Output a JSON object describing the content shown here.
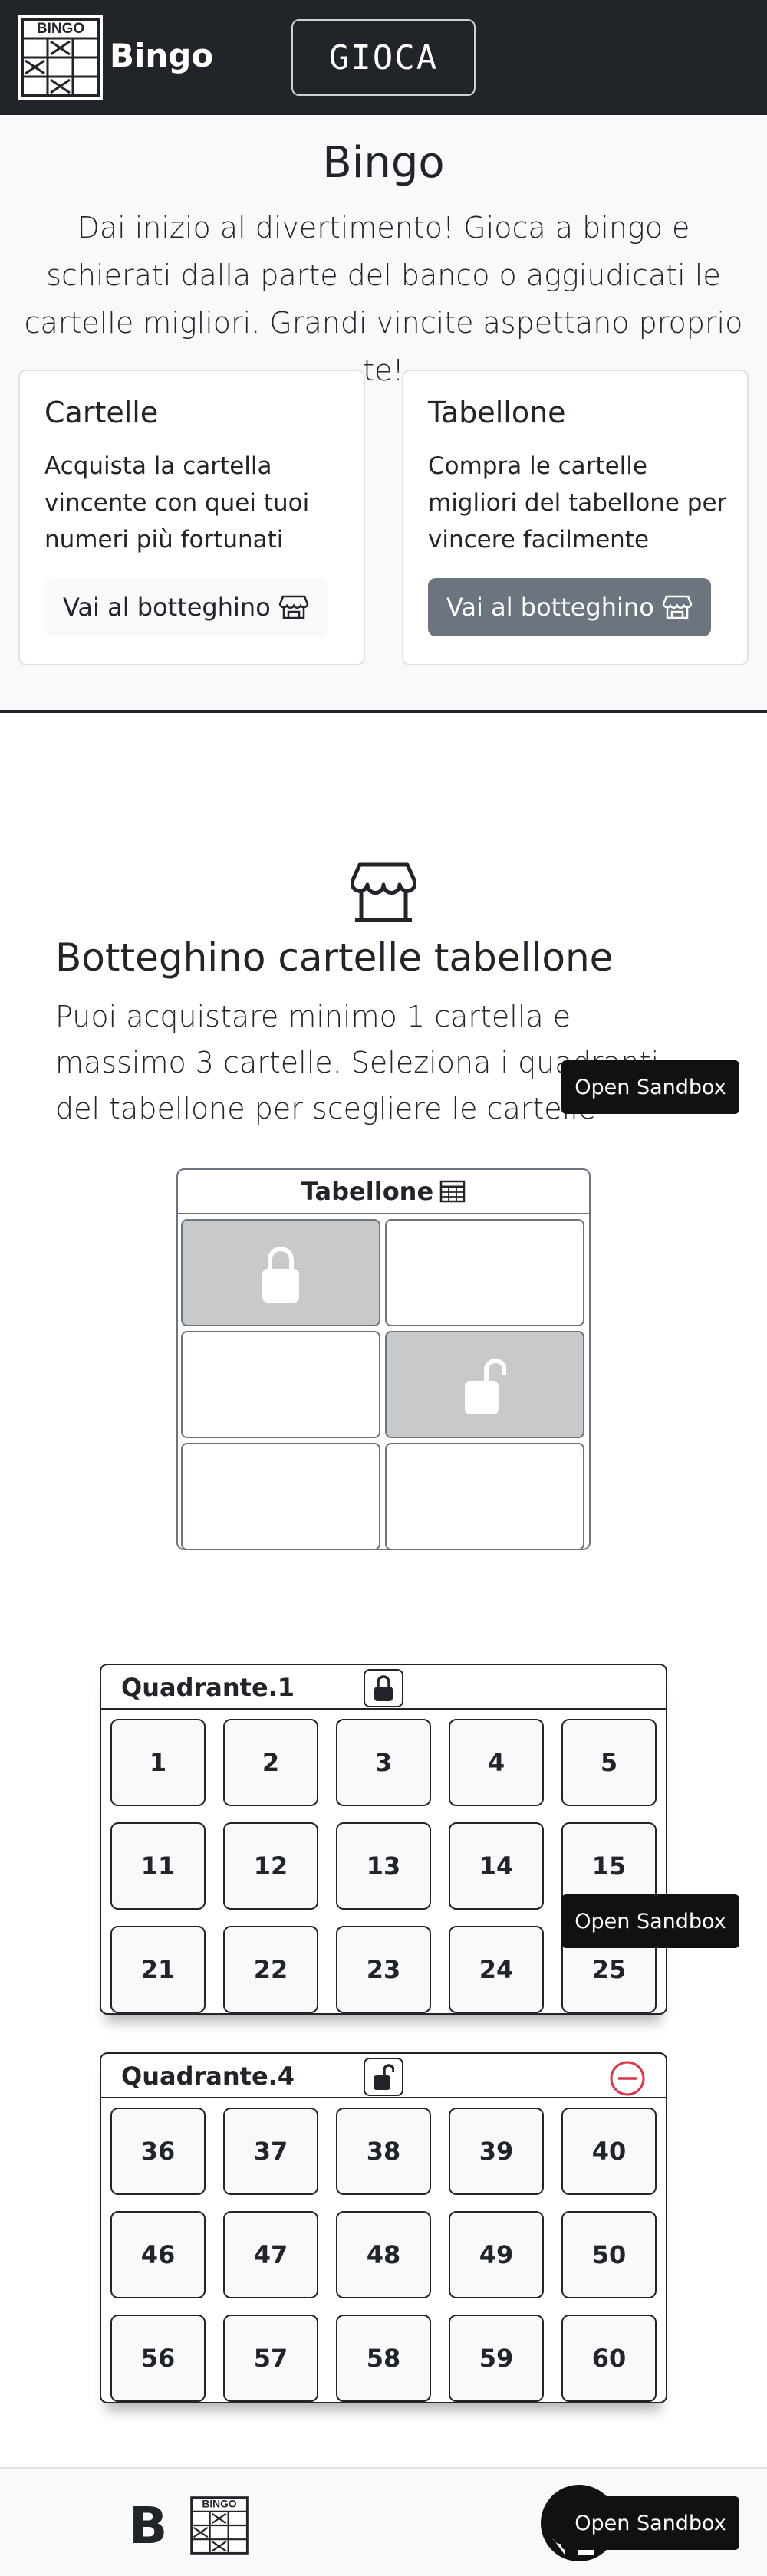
{
  "header": {
    "logo_text": "BINGO",
    "brand": "Bingo",
    "play_label": "GIOCA"
  },
  "hero": {
    "title": "Bingo",
    "lead": "Dai inizio al divertimento! Gioca a bingo e schierati dalla parte del banco o aggiudicati le cartelle migliori. Grandi vincite aspettano proprio te!",
    "cards": [
      {
        "title": "Cartelle",
        "text": "Acquista la cartella vincente con quei tuoi numeri più fortunati",
        "button": "Vai al botteghino",
        "icon": "store-icon",
        "style": "light"
      },
      {
        "title": "Tabellone",
        "text": "Compra le cartelle migliori del tabellone per vincere facilmente",
        "button": "Vai al botteghino",
        "icon": "store-icon",
        "style": "dark"
      }
    ]
  },
  "shop": {
    "icon": "store-icon",
    "title": "Botteghino cartelle tabellone",
    "text": "Puoi acquistare minimo 1 cartella e massimo 3 cartelle. Seleziona i quadranti del tabellone per scegliere le cartelle"
  },
  "tabellone": {
    "title": "Tabellone",
    "icon": "table-icon",
    "cells": [
      {
        "selected": true,
        "icon": "lock-closed-icon"
      },
      {
        "selected": false
      },
      {
        "selected": false
      },
      {
        "selected": true,
        "icon": "lock-open-icon"
      },
      {
        "selected": false
      },
      {
        "selected": false
      }
    ]
  },
  "quadranti": [
    {
      "title": "Quadrante.1",
      "lock": "lock-closed-icon",
      "removable": false,
      "numbers": [
        "1",
        "2",
        "3",
        "4",
        "5",
        "11",
        "12",
        "13",
        "14",
        "15",
        "21",
        "22",
        "23",
        "24",
        "25"
      ]
    },
    {
      "title": "Quadrante.4",
      "lock": "lock-open-icon",
      "removable": true,
      "numbers": [
        "36",
        "37",
        "38",
        "39",
        "40",
        "46",
        "47",
        "48",
        "49",
        "50",
        "56",
        "57",
        "58",
        "59",
        "60"
      ]
    }
  ],
  "sandbox_label": "Open Sandbox",
  "footer": {
    "brand_letter": "B",
    "logo_text": "BINGO",
    "github_icon": "github-icon"
  },
  "colors": {
    "dark": "#212529",
    "light": "#f8f9fa",
    "secondary": "#6c757d",
    "selected_cell": "#c8c9cb",
    "remove": "#dc3545"
  }
}
